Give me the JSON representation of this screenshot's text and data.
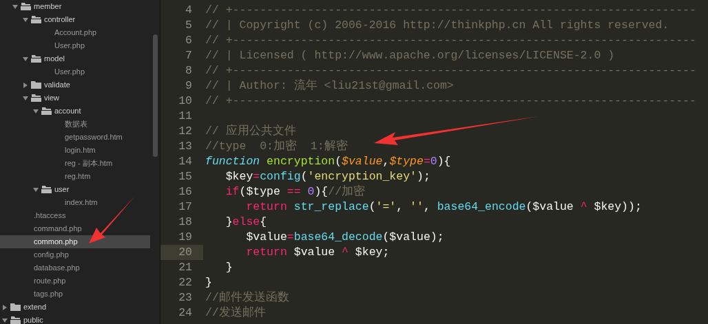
{
  "sidebar": {
    "tree": {
      "partial_folder": {
        "children": [
          {
            "kind": "folder",
            "name": "member",
            "expanded": true,
            "children": [
              {
                "kind": "folder",
                "name": "controller",
                "expanded": true,
                "children": [
                  {
                    "kind": "file",
                    "name": "Account.php",
                    "selected": false
                  },
                  {
                    "kind": "file",
                    "name": "User.php",
                    "selected": false
                  }
                ]
              },
              {
                "kind": "folder",
                "name": "model",
                "expanded": true,
                "children": [
                  {
                    "kind": "file",
                    "name": "User.php",
                    "selected": false
                  }
                ]
              },
              {
                "kind": "folder",
                "name": "validate",
                "expanded": false
              },
              {
                "kind": "folder",
                "name": "view",
                "expanded": true,
                "children": [
                  {
                    "kind": "folder",
                    "name": "account",
                    "expanded": true,
                    "children": [
                      {
                        "kind": "file",
                        "name": "数据表",
                        "selected": false
                      },
                      {
                        "kind": "file",
                        "name": "getpassword.htm",
                        "selected": false
                      },
                      {
                        "kind": "file",
                        "name": "login.htm",
                        "selected": false
                      },
                      {
                        "kind": "file",
                        "name": "reg - 副本.htm",
                        "selected": false
                      },
                      {
                        "kind": "file",
                        "name": "reg.htm",
                        "selected": false
                      }
                    ]
                  },
                  {
                    "kind": "folder",
                    "name": "user",
                    "expanded": true,
                    "children": [
                      {
                        "kind": "file",
                        "name": "index.htm",
                        "selected": false
                      }
                    ]
                  }
                ]
              }
            ]
          },
          {
            "kind": "file",
            "name": ".htaccess",
            "selected": false
          },
          {
            "kind": "file",
            "name": "command.php",
            "selected": false
          },
          {
            "kind": "file",
            "name": "common.php",
            "selected": true
          },
          {
            "kind": "file",
            "name": "config.php",
            "selected": false
          },
          {
            "kind": "file",
            "name": "database.php",
            "selected": false
          },
          {
            "kind": "file",
            "name": "route.php",
            "selected": false
          },
          {
            "kind": "file",
            "name": "tags.php",
            "selected": false
          }
        ]
      },
      "root_items": [
        {
          "kind": "folder",
          "name": "extend",
          "expanded": false
        },
        {
          "kind": "folder",
          "name": "public",
          "expanded": true
        }
      ]
    }
  },
  "editor": {
    "lines": [
      {
        "number": "4",
        "current": false,
        "tokens": [
          {
            "kind": "comment",
            "text": "// +--------------------------------------------------------------------"
          }
        ]
      },
      {
        "number": "5",
        "current": false,
        "tokens": [
          {
            "kind": "comment",
            "text": "// | Copyright (c) 2006-2016 http://thinkphp.cn All rights reserved."
          }
        ]
      },
      {
        "number": "6",
        "current": false,
        "tokens": [
          {
            "kind": "comment",
            "text": "// +--------------------------------------------------------------------"
          }
        ]
      },
      {
        "number": "7",
        "current": false,
        "tokens": [
          {
            "kind": "comment",
            "text": "// | Licensed ( http://www.apache.org/licenses/LICENSE-2.0 )"
          }
        ]
      },
      {
        "number": "8",
        "current": false,
        "tokens": [
          {
            "kind": "comment",
            "text": "// +--------------------------------------------------------------------"
          }
        ]
      },
      {
        "number": "9",
        "current": false,
        "tokens": [
          {
            "kind": "comment",
            "text": "// | Author: 流年 <liu21st@gmail.com>"
          }
        ]
      },
      {
        "number": "10",
        "current": false,
        "tokens": [
          {
            "kind": "comment",
            "text": "// +--------------------------------------------------------------------"
          }
        ]
      },
      {
        "number": "11",
        "current": false
      },
      {
        "number": "12",
        "current": false,
        "tokens": [
          {
            "kind": "comment",
            "text": "// 应用公共文件"
          }
        ]
      },
      {
        "number": "13",
        "current": false,
        "tokens": [
          {
            "kind": "comment",
            "text": "//type  0:加密  1:解密"
          }
        ]
      },
      {
        "number": "14",
        "current": false,
        "tokens": [
          {
            "kind": "storage",
            "text": "function"
          },
          {
            "kind": "entity",
            "text": " encryption"
          },
          {
            "kind": "plain",
            "text": "("
          },
          {
            "kind": "param",
            "text": "$value"
          },
          {
            "kind": "plain",
            "text": ","
          },
          {
            "kind": "param",
            "text": "$type"
          },
          {
            "kind": "keyword",
            "text": "="
          },
          {
            "kind": "number",
            "text": "0"
          },
          {
            "kind": "plain",
            "text": "){"
          }
        ]
      },
      {
        "number": "15",
        "current": false,
        "tokens": [
          {
            "kind": "plain",
            "text": "   $key"
          },
          {
            "kind": "keyword",
            "text": "="
          },
          {
            "kind": "support",
            "text": "config"
          },
          {
            "kind": "plain",
            "text": "("
          },
          {
            "kind": "string",
            "text": "'encryption_key'"
          },
          {
            "kind": "plain",
            "text": ");"
          }
        ]
      },
      {
        "number": "16",
        "current": false,
        "tokens": [
          {
            "kind": "keyword",
            "text": "   if"
          },
          {
            "kind": "plain",
            "text": "($type "
          },
          {
            "kind": "keyword",
            "text": "=="
          },
          {
            "kind": "number",
            "text": " 0"
          },
          {
            "kind": "plain",
            "text": "){"
          },
          {
            "kind": "comment",
            "text": "//加密"
          }
        ]
      },
      {
        "number": "17",
        "current": false,
        "tokens": [
          {
            "kind": "keyword",
            "text": "      return"
          },
          {
            "kind": "support",
            "text": " str_replace"
          },
          {
            "kind": "plain",
            "text": "("
          },
          {
            "kind": "string",
            "text": "'='"
          },
          {
            "kind": "plain",
            "text": ", "
          },
          {
            "kind": "string",
            "text": "''"
          },
          {
            "kind": "plain",
            "text": ", "
          },
          {
            "kind": "support",
            "text": "base64_encode"
          },
          {
            "kind": "plain",
            "text": "($value "
          },
          {
            "kind": "keyword",
            "text": "^"
          },
          {
            "kind": "plain",
            "text": " $key));"
          }
        ]
      },
      {
        "number": "18",
        "current": false,
        "tokens": [
          {
            "kind": "plain",
            "text": "   }"
          },
          {
            "kind": "keyword",
            "text": "else"
          },
          {
            "kind": "plain",
            "text": "{"
          }
        ]
      },
      {
        "number": "19",
        "current": false,
        "tokens": [
          {
            "kind": "plain",
            "text": "      $value"
          },
          {
            "kind": "keyword",
            "text": "="
          },
          {
            "kind": "support",
            "text": "base64_decode"
          },
          {
            "kind": "plain",
            "text": "($value);"
          }
        ]
      },
      {
        "number": "20",
        "current": true,
        "tokens": [
          {
            "kind": "keyword",
            "text": "      return"
          },
          {
            "kind": "plain",
            "text": " $value "
          },
          {
            "kind": "keyword",
            "text": "^"
          },
          {
            "kind": "plain",
            "text": " $key;"
          }
        ]
      },
      {
        "number": "21",
        "current": false,
        "tokens": [
          {
            "kind": "plain",
            "text": "   }"
          }
        ]
      },
      {
        "number": "22",
        "current": false,
        "tokens": [
          {
            "kind": "plain",
            "text": "}"
          }
        ]
      },
      {
        "number": "23",
        "current": false,
        "tokens": [
          {
            "kind": "comment",
            "text": "//邮件发送函数"
          }
        ]
      },
      {
        "number": "24",
        "current": false,
        "tokens": [
          {
            "kind": "comment",
            "text": "//发送邮件"
          }
        ]
      }
    ]
  }
}
